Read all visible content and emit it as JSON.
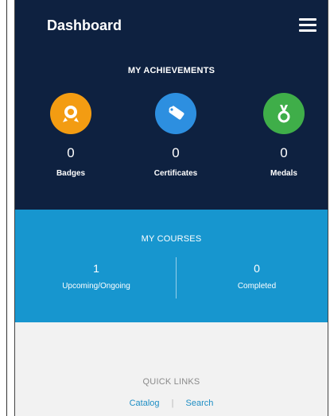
{
  "header": {
    "title": "Dashboard",
    "menu_icon": "hamburger-menu-icon"
  },
  "achievements": {
    "title": "MY ACHIEVEMENTS",
    "items": [
      {
        "label": "Badges",
        "count": "0",
        "icon": "badge-icon",
        "color": "#f39c12"
      },
      {
        "label": "Certificates",
        "count": "0",
        "icon": "certificate-icon",
        "color": "#2d8fe0"
      },
      {
        "label": "Medals",
        "count": "0",
        "icon": "medal-icon",
        "color": "#3fae49"
      }
    ]
  },
  "courses": {
    "title": "MY COURSES",
    "stats": [
      {
        "label": "Upcoming/Ongoing",
        "count": "1"
      },
      {
        "label": "Completed",
        "count": "0"
      }
    ]
  },
  "quick_links": {
    "title": "QUICK LINKS",
    "links": [
      "Catalog",
      "Search"
    ]
  },
  "colors": {
    "header_bg": "#0e2140",
    "courses_bg": "#1796cf",
    "quick_bg": "#f2f2f2",
    "link": "#1e8ec4"
  }
}
